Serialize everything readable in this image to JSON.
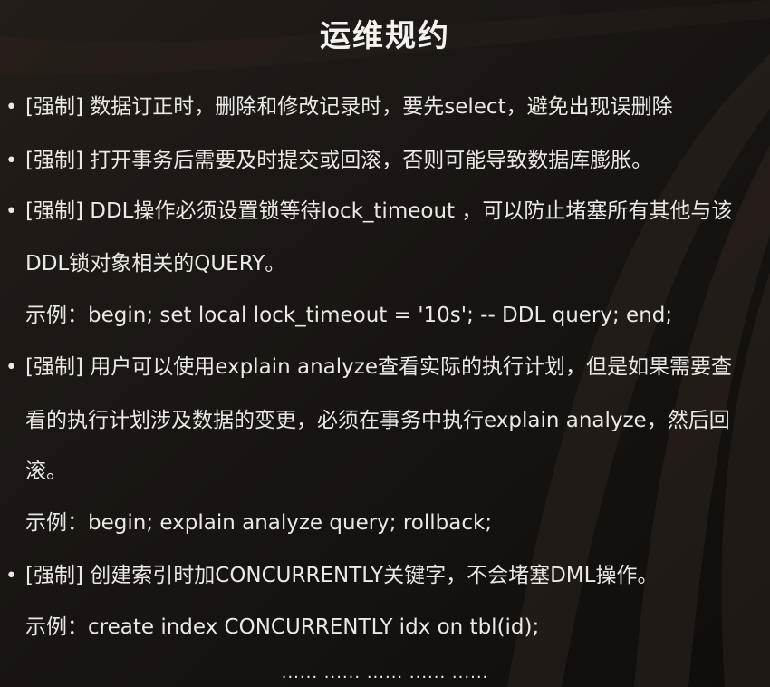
{
  "title": "运维规约",
  "lines": {
    "l1": "[强制] 数据订正时，删除和修改记录时，要先select，避免出现误删除",
    "l2": "[强制] 打开事务后需要及时提交或回滚，否则可能导致数据库膨胀。",
    "l3": "[强制] DDL操作必须设置锁等待lock_timeout ，可以防止堵塞所有其他与该",
    "l4": "DDL锁对象相关的QUERY。",
    "l5": "示例：begin; set local lock_timeout = '10s'; -- DDL query; end;",
    "l6": "[强制] 用户可以使用explain analyze查看实际的执行计划，但是如果需要查",
    "l7": "看的执行计划涉及数据的变更，必须在事务中执行explain analyze，然后回",
    "l8": "滚。",
    "l9": "示例：begin; explain analyze query; rollback;",
    "l10": "[强制] 创建索引时加CONCURRENTLY关键字，不会堵塞DML操作。",
    "l11": "示例：create index CONCURRENTLY idx on tbl(id);"
  },
  "bullet_glyph": "•",
  "ellipsis": "...... ...... ...... ...... ......"
}
